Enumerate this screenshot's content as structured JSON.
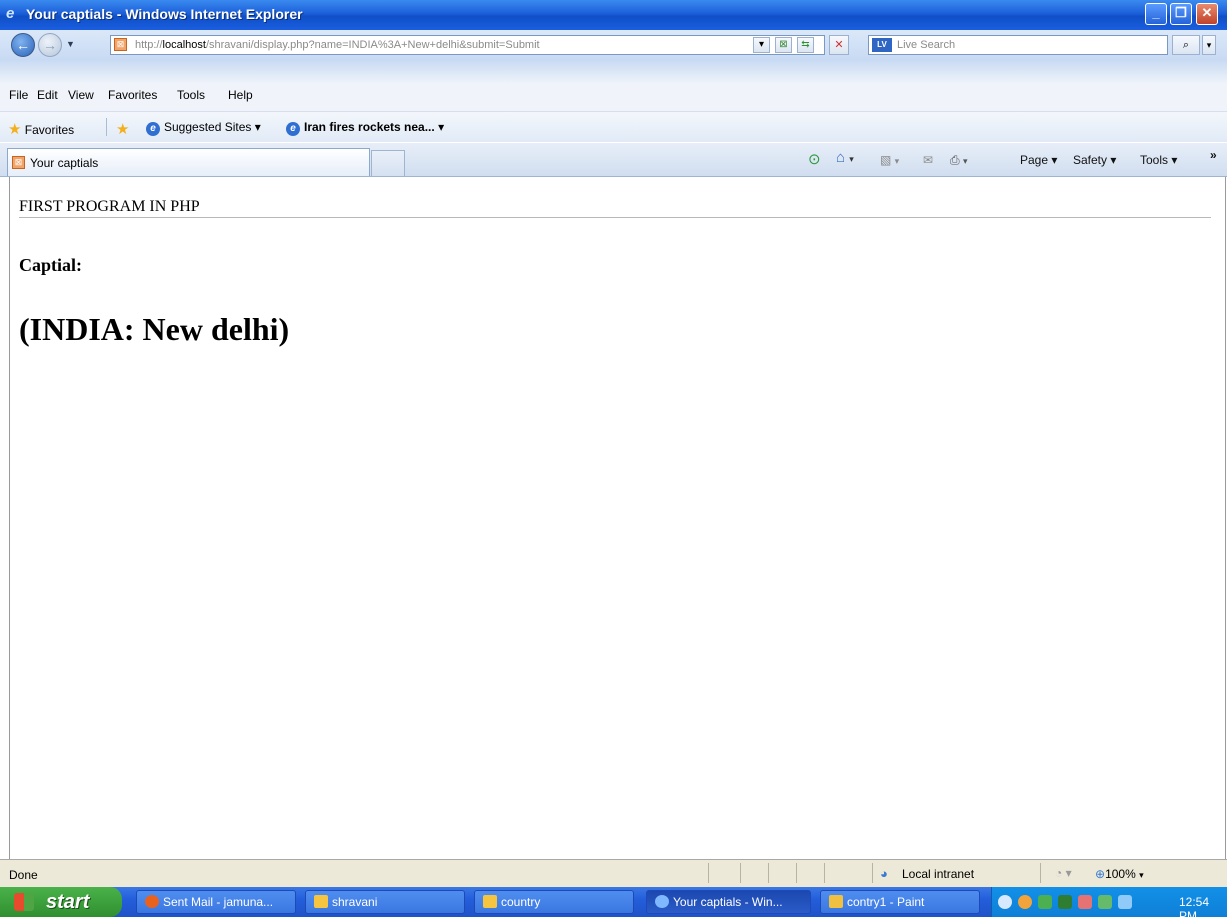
{
  "window": {
    "title": "Your captials - Windows Internet Explorer"
  },
  "address_bar": {
    "url_prefix": "http://",
    "url_host": "localhost",
    "url_path": "/shravani/display.php?name=INDIA%3A+New+delhi&submit=Submit",
    "search_placeholder": "Live Search",
    "search_provider_icon": "LV"
  },
  "menu": {
    "items": [
      "File",
      "Edit",
      "View",
      "Favorites",
      "Tools",
      "Help"
    ]
  },
  "favorites_bar": {
    "favorites_label": "Favorites",
    "suggested_sites": "Suggested Sites",
    "feed_item": "Iran fires rockets nea..."
  },
  "tab": {
    "label": "Your captials"
  },
  "command_bar": {
    "page": "Page",
    "safety": "Safety",
    "tools": "Tools",
    "more": "»"
  },
  "content": {
    "heading": "FIRST PROGRAM IN PHP",
    "label": "Captial:",
    "answer": "(INDIA: New delhi)"
  },
  "status_bar": {
    "status": "Done",
    "zone": "Local intranet",
    "zoom": "100%"
  },
  "taskbar": {
    "start_label": "start",
    "buttons": [
      {
        "label": "Sent Mail - jamuna...",
        "icon": "firefox-icon",
        "color": "#e8621e"
      },
      {
        "label": "shravani",
        "icon": "folder-icon",
        "color": "#f5c542"
      },
      {
        "label": "country",
        "icon": "folder-icon",
        "color": "#f5c542"
      },
      {
        "label": "Your captials - Win...",
        "icon": "ie-icon",
        "color": "#7fb8ff"
      },
      {
        "label": "contry1 - Paint",
        "icon": "paint-icon",
        "color": "#f0c040"
      }
    ],
    "clock": "12:54 PM"
  }
}
